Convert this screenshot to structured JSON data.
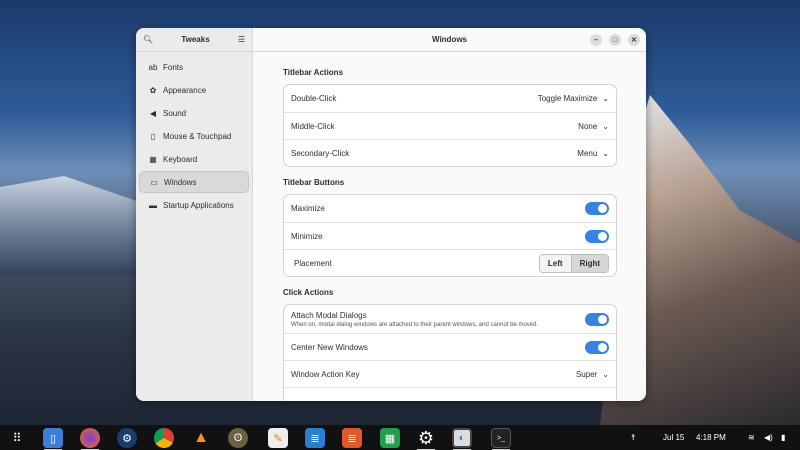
{
  "sidebar": {
    "title": "Tweaks",
    "items": [
      {
        "label": "Fonts",
        "icon": "ab"
      },
      {
        "label": "Appearance",
        "icon": "✿"
      },
      {
        "label": "Sound",
        "icon": "◀"
      },
      {
        "label": "Mouse & Touchpad",
        "icon": "▯"
      },
      {
        "label": "Keyboard",
        "icon": "▦"
      },
      {
        "label": "Windows",
        "icon": "▭"
      },
      {
        "label": "Startup Applications",
        "icon": "▬"
      }
    ]
  },
  "header": {
    "title": "Windows",
    "minimize": "–",
    "maximize": "□",
    "close": "✕"
  },
  "sections": {
    "titlebar_actions": {
      "title": "Titlebar Actions",
      "rows": [
        {
          "label": "Double-Click",
          "value": "Toggle Maximize"
        },
        {
          "label": "Middle-Click",
          "value": "None"
        },
        {
          "label": "Secondary-Click",
          "value": "Menu"
        }
      ]
    },
    "titlebar_buttons": {
      "title": "Titlebar Buttons",
      "maximize": "Maximize",
      "minimize": "Minimize",
      "placement": "Placement",
      "left": "Left",
      "right": "Right",
      "placement_selected": "Right"
    },
    "click_actions": {
      "title": "Click Actions",
      "attach": "Attach Modal Dialogs",
      "attach_desc": "When on, modal dialog windows are attached to their parent windows, and cannot be moved.",
      "center": "Center New Windows",
      "key_label": "Window Action Key",
      "key_value": "Super"
    }
  },
  "toggles": {
    "maximize": true,
    "minimize": true,
    "attach_modal": true,
    "center_new": true
  },
  "taskbar": {
    "date": "Jul 15",
    "time": "4:18 PM",
    "apps": [
      "files",
      "firefox",
      "steam",
      "chrome",
      "vlc",
      "gimp",
      "text-editor",
      "writer",
      "impress",
      "calc",
      "settings",
      "tweaks",
      "terminal"
    ]
  },
  "colors": {
    "accent": "#3584e4"
  }
}
